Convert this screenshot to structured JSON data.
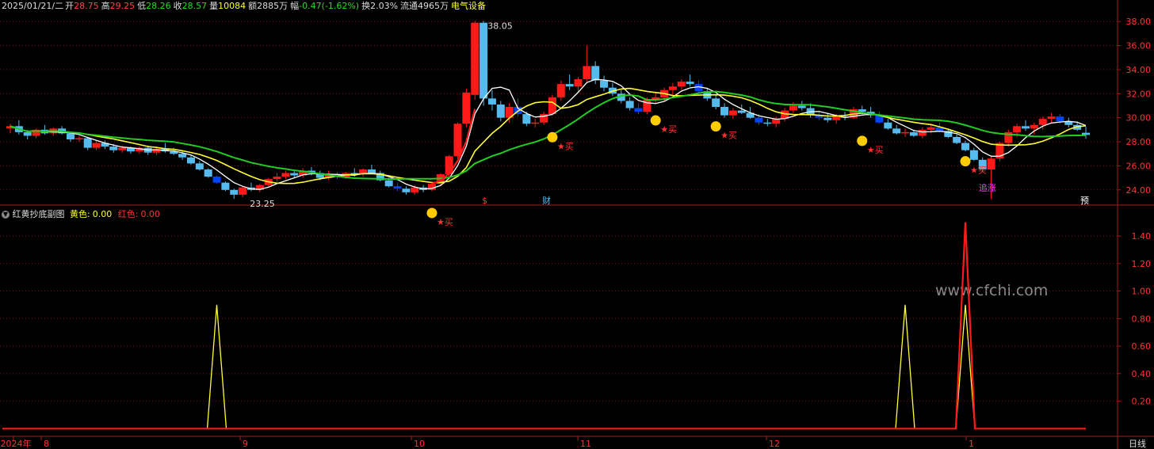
{
  "header": {
    "date": "2025/01/21/二",
    "open_label": "开",
    "open": "28.75",
    "high_label": "高",
    "high": "29.25",
    "low_label": "低",
    "low": "28.26",
    "close_label": "收",
    "close": "28.57",
    "vol_label": "量",
    "vol": "10084",
    "amt_label": "额",
    "amt": "2885万",
    "chg_label": "幅",
    "chg": "-0.47(-1.62%)",
    "turn_label": "换",
    "turn": "2.03%",
    "float_label": "流通",
    "float": "4965万",
    "sector": "电气设备"
  },
  "sub_header": {
    "title": "红黄抄底副图",
    "yellow_label": "黄色:",
    "yellow_val": "0.00",
    "red_label": "红色:",
    "red_val": "0.00"
  },
  "annotations": {
    "max_price": "38.05",
    "min_price": "23.25",
    "buy": "买",
    "chase": "追涨",
    "dividend": "$",
    "finance": "财",
    "forecast": "预"
  },
  "watermark": "www.cfchi.com",
  "colors": {
    "up": "#ff1a1a",
    "down": "#55bbee",
    "down_dark": "#0044ff",
    "ma_white": "#ffffff",
    "ma_yellow": "#ffff33",
    "ma_green": "#22cc22",
    "grid": "#7a1010",
    "axis": "#aa1a1a"
  },
  "chart_data": [
    {
      "type": "candlestick",
      "title": "",
      "y_ticks": [
        "38.00",
        "36.00",
        "34.00",
        "32.00",
        "30.00",
        "28.00",
        "26.00",
        "24.00"
      ],
      "ylim": [
        22.8,
        39.0
      ],
      "x_ticks": [
        "2024年",
        "8",
        "9",
        "10",
        "11",
        "12",
        "1"
      ],
      "x_axis_label": "日线",
      "ohlc": [
        [
          29.1,
          29.5,
          28.7,
          29.3
        ],
        [
          29.3,
          29.8,
          28.6,
          28.8
        ],
        [
          28.8,
          29.0,
          28.2,
          28.5
        ],
        [
          28.5,
          29.1,
          28.3,
          29.0
        ],
        [
          29.0,
          29.4,
          28.6,
          28.7
        ],
        [
          28.7,
          29.2,
          28.5,
          29.1
        ],
        [
          29.1,
          29.3,
          28.6,
          28.7
        ],
        [
          28.7,
          28.8,
          28.0,
          28.2
        ],
        [
          28.2,
          28.5,
          28.0,
          28.3
        ],
        [
          28.3,
          28.4,
          27.3,
          27.5
        ],
        [
          27.5,
          28.1,
          27.3,
          27.9
        ],
        [
          27.9,
          28.1,
          27.4,
          27.6
        ],
        [
          27.6,
          27.8,
          27.1,
          27.3
        ],
        [
          27.3,
          27.7,
          27.1,
          27.5
        ],
        [
          27.5,
          27.6,
          27.0,
          27.2
        ],
        [
          27.2,
          27.6,
          27.0,
          27.5
        ],
        [
          27.5,
          27.7,
          26.9,
          27.1
        ],
        [
          27.1,
          27.6,
          26.9,
          27.4
        ],
        [
          27.4,
          27.9,
          27.1,
          27.2
        ],
        [
          27.2,
          27.5,
          26.9,
          27.0
        ],
        [
          27.0,
          27.3,
          26.5,
          26.7
        ],
        [
          26.7,
          26.9,
          26.1,
          26.2
        ],
        [
          26.2,
          26.4,
          25.6,
          25.7
        ],
        [
          25.7,
          25.8,
          25.0,
          25.1
        ],
        [
          25.1,
          25.2,
          24.5,
          24.6
        ],
        [
          24.6,
          24.7,
          23.9,
          24.0
        ],
        [
          24.0,
          24.1,
          23.25,
          23.6
        ],
        [
          23.6,
          24.3,
          23.4,
          24.2
        ],
        [
          24.2,
          24.6,
          23.9,
          24.0
        ],
        [
          24.0,
          24.5,
          23.8,
          24.4
        ],
        [
          24.4,
          25.0,
          24.2,
          24.9
        ],
        [
          24.9,
          25.4,
          24.7,
          25.1
        ],
        [
          25.1,
          25.6,
          24.9,
          25.4
        ],
        [
          25.4,
          25.7,
          25.0,
          25.2
        ],
        [
          25.2,
          25.8,
          25.0,
          25.6
        ],
        [
          25.6,
          25.9,
          25.2,
          25.4
        ],
        [
          25.4,
          25.6,
          24.8,
          25.0
        ],
        [
          25.0,
          25.6,
          24.8,
          25.3
        ],
        [
          25.3,
          25.5,
          24.9,
          25.1
        ],
        [
          25.1,
          25.5,
          24.9,
          25.4
        ],
        [
          25.4,
          25.8,
          25.1,
          25.3
        ],
        [
          25.3,
          25.8,
          25.1,
          25.7
        ],
        [
          25.7,
          26.1,
          25.3,
          25.4
        ],
        [
          25.4,
          25.6,
          24.7,
          24.8
        ],
        [
          24.8,
          25.0,
          24.2,
          24.3
        ],
        [
          24.3,
          24.6,
          23.9,
          24.1
        ],
        [
          24.1,
          24.3,
          23.6,
          23.8
        ],
        [
          23.8,
          24.4,
          23.6,
          24.2
        ],
        [
          24.2,
          24.4,
          23.8,
          24.0
        ],
        [
          24.0,
          24.6,
          23.9,
          24.5
        ],
        [
          24.5,
          25.4,
          24.3,
          25.3
        ],
        [
          25.3,
          26.9,
          25.1,
          26.8
        ],
        [
          26.8,
          29.6,
          26.6,
          29.5
        ],
        [
          29.5,
          32.4,
          29.2,
          32.1
        ],
        [
          31.9,
          38.05,
          31.5,
          37.9
        ],
        [
          37.9,
          38.05,
          31.0,
          31.6
        ],
        [
          31.6,
          32.3,
          30.6,
          31.1
        ],
        [
          31.1,
          31.4,
          29.7,
          30.0
        ],
        [
          30.0,
          31.2,
          29.6,
          30.9
        ],
        [
          30.9,
          31.6,
          30.1,
          30.3
        ],
        [
          30.3,
          30.5,
          29.3,
          29.5
        ],
        [
          29.5,
          29.9,
          29.2,
          29.6
        ],
        [
          29.6,
          30.5,
          29.4,
          30.3
        ],
        [
          30.3,
          31.9,
          30.2,
          31.7
        ],
        [
          31.7,
          33.1,
          31.4,
          32.8
        ],
        [
          32.8,
          33.6,
          32.3,
          32.6
        ],
        [
          32.6,
          33.4,
          32.1,
          33.2
        ],
        [
          33.2,
          36.0,
          33.0,
          34.3
        ],
        [
          34.3,
          34.7,
          32.8,
          33.1
        ],
        [
          33.1,
          33.5,
          32.2,
          32.5
        ],
        [
          32.5,
          32.9,
          31.8,
          32.0
        ],
        [
          32.0,
          32.3,
          31.2,
          31.4
        ],
        [
          31.4,
          31.7,
          30.6,
          30.8
        ],
        [
          30.8,
          31.2,
          30.3,
          30.5
        ],
        [
          30.5,
          31.7,
          30.3,
          31.5
        ],
        [
          31.5,
          32.1,
          31.2,
          31.7
        ],
        [
          31.7,
          32.5,
          31.4,
          32.3
        ],
        [
          32.3,
          32.9,
          31.9,
          32.6
        ],
        [
          32.6,
          33.2,
          32.3,
          33.0
        ],
        [
          33.0,
          33.6,
          32.6,
          32.8
        ],
        [
          32.8,
          33.1,
          32.0,
          32.2
        ],
        [
          32.2,
          32.5,
          31.4,
          31.6
        ],
        [
          31.6,
          31.9,
          30.7,
          30.9
        ],
        [
          30.9,
          31.2,
          30.0,
          30.2
        ],
        [
          30.2,
          30.8,
          29.9,
          30.6
        ],
        [
          30.6,
          31.1,
          30.3,
          30.4
        ],
        [
          30.4,
          30.9,
          29.9,
          30.0
        ],
        [
          30.0,
          30.3,
          29.4,
          29.6
        ],
        [
          29.6,
          29.9,
          29.3,
          29.5
        ],
        [
          29.5,
          30.1,
          29.2,
          29.9
        ],
        [
          29.9,
          30.8,
          29.7,
          30.6
        ],
        [
          30.6,
          31.3,
          30.4,
          31.0
        ],
        [
          31.0,
          31.4,
          30.6,
          30.8
        ],
        [
          30.8,
          31.2,
          30.0,
          30.2
        ],
        [
          30.2,
          30.6,
          29.8,
          30.0
        ],
        [
          30.0,
          30.4,
          29.6,
          29.8
        ],
        [
          29.8,
          30.3,
          29.5,
          30.1
        ],
        [
          30.1,
          30.5,
          29.8,
          30.0
        ],
        [
          30.0,
          30.9,
          29.9,
          30.7
        ],
        [
          30.7,
          31.0,
          30.3,
          30.5
        ],
        [
          30.5,
          30.9,
          30.0,
          30.2
        ],
        [
          30.2,
          30.5,
          29.5,
          29.6
        ],
        [
          29.6,
          29.9,
          29.0,
          29.1
        ],
        [
          29.1,
          29.4,
          28.6,
          28.7
        ],
        [
          28.7,
          29.1,
          28.4,
          28.8
        ],
        [
          28.8,
          29.0,
          28.4,
          28.5
        ],
        [
          28.5,
          29.2,
          28.3,
          29.0
        ],
        [
          29.0,
          29.5,
          28.7,
          29.2
        ],
        [
          29.2,
          29.6,
          28.8,
          28.9
        ],
        [
          28.9,
          29.1,
          28.3,
          28.4
        ],
        [
          28.4,
          28.6,
          27.8,
          27.9
        ],
        [
          27.9,
          28.1,
          27.2,
          27.3
        ],
        [
          27.3,
          27.5,
          26.4,
          26.5
        ],
        [
          26.5,
          26.7,
          25.5,
          25.7
        ],
        [
          25.7,
          26.8,
          23.25,
          26.6
        ],
        [
          26.6,
          28.0,
          26.4,
          27.9
        ],
        [
          27.9,
          29.0,
          27.6,
          28.8
        ],
        [
          28.8,
          29.5,
          28.4,
          29.3
        ],
        [
          29.3,
          29.8,
          28.9,
          29.1
        ],
        [
          29.1,
          29.6,
          28.6,
          29.4
        ],
        [
          29.4,
          30.1,
          29.0,
          29.9
        ],
        [
          29.9,
          30.4,
          29.5,
          30.1
        ],
        [
          30.1,
          30.3,
          29.5,
          29.7
        ],
        [
          29.7,
          30.0,
          29.2,
          29.4
        ],
        [
          29.4,
          29.7,
          28.9,
          29.0
        ],
        [
          28.75,
          29.25,
          28.26,
          28.57
        ]
      ]
    },
    {
      "type": "line",
      "title": "",
      "y_ticks": [
        "1.40",
        "1.20",
        "1.00",
        "0.80",
        "0.60",
        "0.40",
        "0.20"
      ],
      "ylim": [
        -0.05,
        1.55
      ],
      "series": [
        {
          "name": "黄色",
          "spikes": [
            {
              "index": 24,
              "value": 0.9
            },
            {
              "index": 104,
              "value": 0.9
            },
            {
              "index": 111,
              "value": 0.9
            }
          ]
        },
        {
          "name": "红色",
          "spikes": [
            {
              "index": 111,
              "value": 1.5
            }
          ]
        }
      ]
    }
  ]
}
